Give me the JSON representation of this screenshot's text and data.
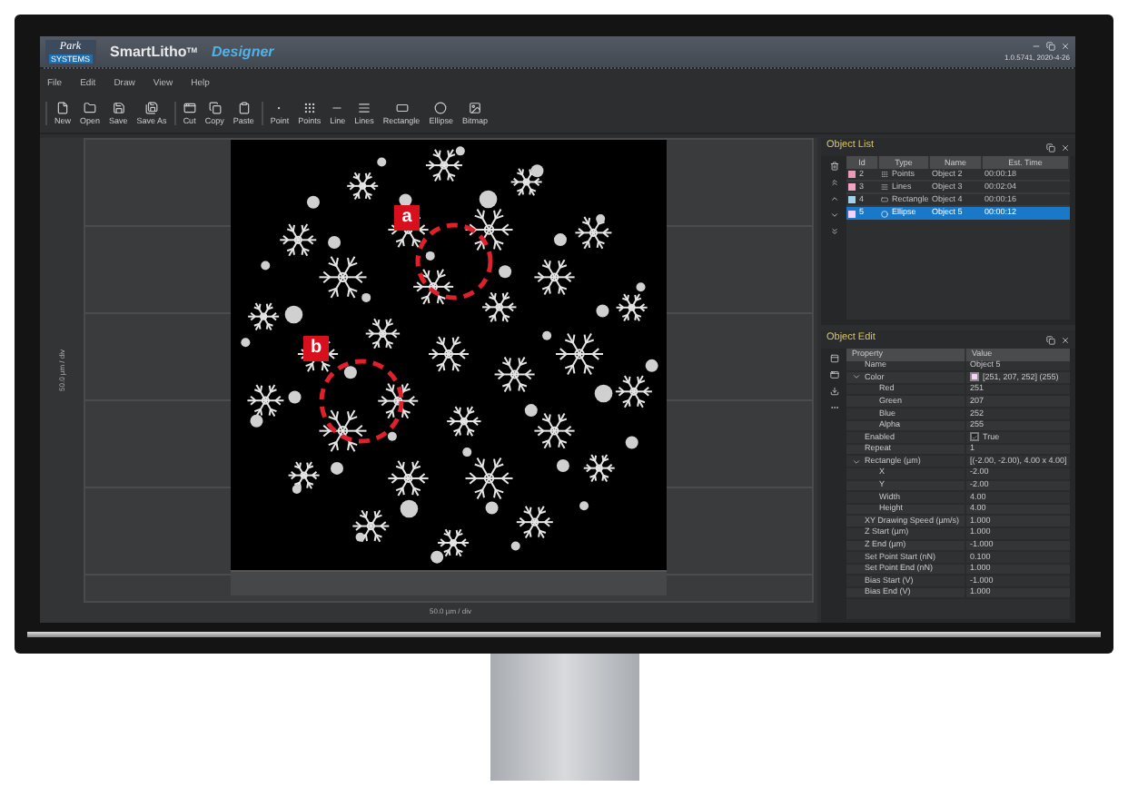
{
  "window": {
    "logo": "Park",
    "logo_sub": "SYSTEMS",
    "title": "SmartLitho",
    "title_mark": "TM",
    "subtitle": "Designer",
    "version": "1.0.5741, 2020-4-26"
  },
  "menu": [
    "File",
    "Edit",
    "Draw",
    "View",
    "Help"
  ],
  "toolbar": [
    [
      {
        "label": "New",
        "kind": "new"
      },
      {
        "label": "Open",
        "kind": "open"
      },
      {
        "label": "Save",
        "kind": "save"
      },
      {
        "label": "Save As",
        "kind": "save-as"
      }
    ],
    [
      {
        "label": "Cut",
        "kind": "cut"
      },
      {
        "label": "Copy",
        "kind": "copy"
      },
      {
        "label": "Paste",
        "kind": "paste"
      }
    ],
    [
      {
        "label": "Point",
        "kind": "point"
      },
      {
        "label": "Points",
        "kind": "points"
      },
      {
        "label": "Line",
        "kind": "line"
      },
      {
        "label": "Lines",
        "kind": "lines"
      },
      {
        "label": "Rectangle",
        "kind": "rectangle"
      },
      {
        "label": "Ellipse",
        "kind": "ellipse"
      },
      {
        "label": "Bitmap",
        "kind": "bitmap"
      }
    ]
  ],
  "canvas": {
    "y_axis_label": "50.0 µm / div",
    "x_axis_label": "50.0 µm / div",
    "callouts": [
      "a",
      "b"
    ]
  },
  "object_list": {
    "title": "Object List",
    "columns": [
      "Id",
      "Type",
      "Name",
      "Est. Time"
    ],
    "rows": [
      {
        "id": "2",
        "type": "Points",
        "kind": "points",
        "name": "Object 2",
        "time": "00:00:18",
        "color": "#e99ab9",
        "selected": false
      },
      {
        "id": "3",
        "type": "Lines",
        "kind": "lines",
        "name": "Object 3",
        "time": "00:02:04",
        "color": "#f2a2c4",
        "selected": false
      },
      {
        "id": "4",
        "type": "Rectangle",
        "kind": "rectangle",
        "name": "Object 4",
        "time": "00:00:16",
        "color": "#a2d2ea",
        "selected": false
      },
      {
        "id": "5",
        "type": "Ellipse",
        "kind": "ellipse",
        "name": "Object 5",
        "time": "00:00:12",
        "color": "#fbcffc",
        "selected": true
      }
    ]
  },
  "object_edit": {
    "title": "Object Edit",
    "columns": [
      "Property",
      "Value"
    ],
    "rows": [
      {
        "property": "Name",
        "value": "Object 5"
      },
      {
        "property": "Color",
        "value": "[251, 207, 252] (255)",
        "color": "#fbcffc",
        "expanded": true,
        "children": [
          {
            "property": "Red",
            "value": "251"
          },
          {
            "property": "Green",
            "value": "207"
          },
          {
            "property": "Blue",
            "value": "252"
          },
          {
            "property": "Alpha",
            "value": "255"
          }
        ]
      },
      {
        "property": "Enabled",
        "value": "True",
        "checked": true
      },
      {
        "property": "Repeat",
        "value": "1"
      },
      {
        "property": "Rectangle (µm)",
        "value": "[(-2.00, -2.00), 4.00 x 4.00]",
        "expanded": true,
        "children": [
          {
            "property": "X",
            "value": "-2.00"
          },
          {
            "property": "Y",
            "value": "-2.00"
          },
          {
            "property": "Width",
            "value": "4.00"
          },
          {
            "property": "Height",
            "value": "4.00"
          }
        ]
      },
      {
        "property": "XY Drawing Speed (µm/s)",
        "value": "1.000"
      },
      {
        "property": "Z Start (µm)",
        "value": "1.000"
      },
      {
        "property": "Z End (µm)",
        "value": "-1.000"
      },
      {
        "property": "Set Point Start (nN)",
        "value": "0.100"
      },
      {
        "property": "Set Point End (nN)",
        "value": "1.000"
      },
      {
        "property": "Bias Start (V)",
        "value": "-1.000"
      },
      {
        "property": "Bias End (V)",
        "value": "1.000"
      }
    ]
  }
}
